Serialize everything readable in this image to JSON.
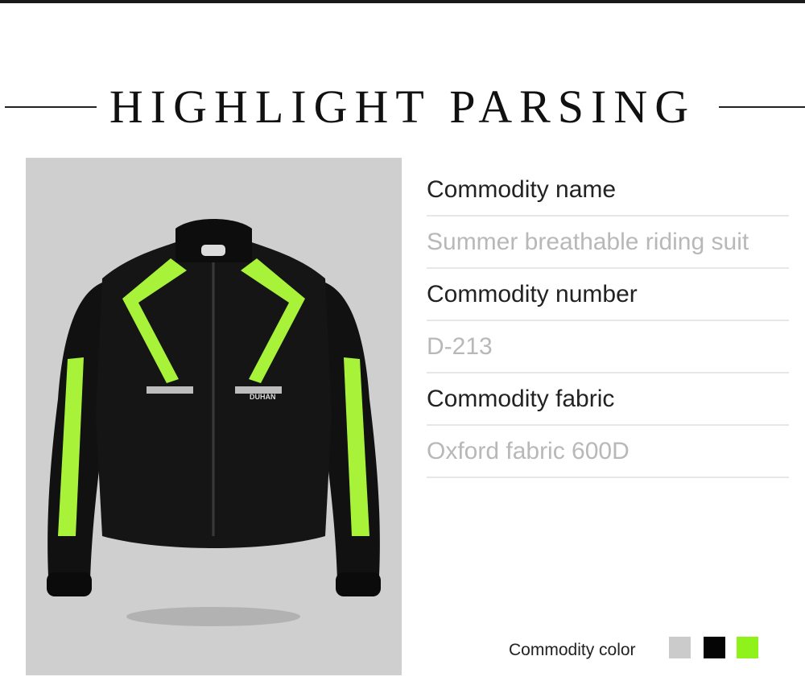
{
  "heading": "HIGHLIGHT PARSING",
  "product_image": {
    "description_icon": "motorcycle-jacket-photo",
    "logo_text": "DUHAN",
    "colors": {
      "background": "#cfcfcf",
      "jacket": "#111111",
      "accent": "#a8f23a"
    }
  },
  "specs": [
    {
      "label": "Commodity name",
      "value": "Summer breathable riding suit"
    },
    {
      "label": "Commodity number",
      "value": "D-213"
    },
    {
      "label": "Commodity fabric",
      "value": "Oxford fabric 600D"
    }
  ],
  "color_option": {
    "label": "Commodity color",
    "swatches": [
      "#cbcbcb",
      "#050505",
      "#8ff21a"
    ]
  }
}
